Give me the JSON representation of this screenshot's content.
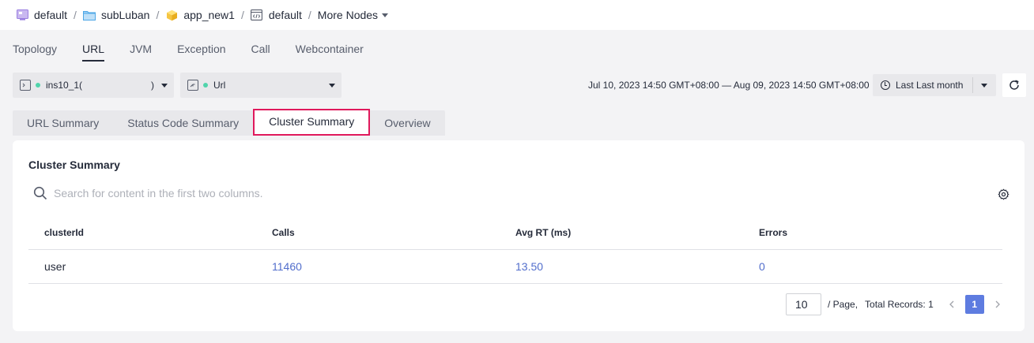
{
  "breadcrumb": {
    "items": [
      {
        "label": "default",
        "icon": "workspace-icon"
      },
      {
        "label": "subLuban",
        "icon": "folder-icon"
      },
      {
        "label": "app_new1",
        "icon": "cube-icon"
      },
      {
        "label": "default",
        "icon": "code-window-icon"
      }
    ],
    "more_label": "More Nodes",
    "separator": "/"
  },
  "top_tabs": [
    {
      "label": "Topology"
    },
    {
      "label": "URL",
      "active": true
    },
    {
      "label": "JVM"
    },
    {
      "label": "Exception"
    },
    {
      "label": "Call"
    },
    {
      "label": "Webcontainer"
    }
  ],
  "instance_select": {
    "value": "ins10_1(",
    "suffix": ")"
  },
  "type_select": {
    "value": "Url"
  },
  "time_range": {
    "text": "Jul 10, 2023 14:50 GMT+08:00 — Aug 09, 2023 14:50 GMT+08:00",
    "preset": "Last Last month"
  },
  "sub_tabs": [
    {
      "label": "URL Summary"
    },
    {
      "label": "Status Code Summary"
    },
    {
      "label": "Cluster Summary",
      "active": true
    },
    {
      "label": "Overview"
    }
  ],
  "card": {
    "title": "Cluster Summary",
    "search_placeholder": "Search for content in the first two columns."
  },
  "table": {
    "columns": [
      "clusterId",
      "Calls",
      "Avg RT (ms)",
      "Errors"
    ],
    "rows": [
      [
        "user",
        "11460",
        "13.50",
        "0"
      ]
    ]
  },
  "pagination": {
    "page_size": "10",
    "per_page_label": "/ Page,",
    "total_label": "Total Records: 1",
    "current_page": "1"
  },
  "colors": {
    "accent": "#5e7ce0",
    "link": "#526ecc",
    "highlight_border": "#e0195c",
    "status_dot": "#50d4ab"
  }
}
